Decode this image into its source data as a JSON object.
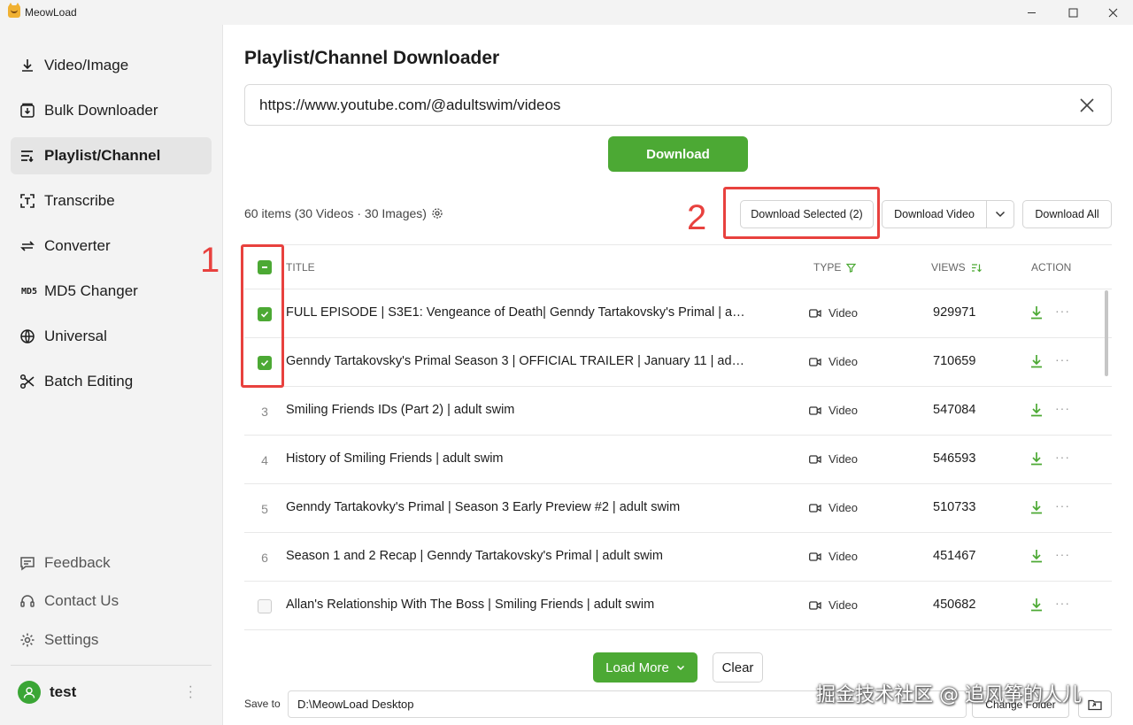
{
  "window": {
    "title": "MeowLoad",
    "minimize": "—",
    "maximize": "☐",
    "close": "✕"
  },
  "sidebar": {
    "items": [
      {
        "label": "Video/Image",
        "icon": "download-icon",
        "active": false
      },
      {
        "label": "Bulk Downloader",
        "icon": "bulk-download-icon",
        "active": false
      },
      {
        "label": "Playlist/Channel",
        "icon": "playlist-icon",
        "active": true
      },
      {
        "label": "Transcribe",
        "icon": "transcribe-icon",
        "active": false
      },
      {
        "label": "Converter",
        "icon": "converter-icon",
        "active": false
      },
      {
        "label": "MD5 Changer",
        "icon": "md5-icon",
        "icon_text": "MD5",
        "active": false
      },
      {
        "label": "Universal",
        "icon": "globe-icon",
        "active": false
      },
      {
        "label": "Batch Editing",
        "icon": "scissors-icon",
        "active": false
      }
    ],
    "bottom": [
      {
        "label": "Feedback",
        "icon": "feedback-icon"
      },
      {
        "label": "Contact Us",
        "icon": "headset-icon"
      },
      {
        "label": "Settings",
        "icon": "gear-icon"
      }
    ],
    "user": {
      "name": "test",
      "more": "⋮"
    }
  },
  "main": {
    "title": "Playlist/Channel Downloader",
    "url_value": "https://www.youtube.com/@adultswim/videos",
    "download_label": "Download",
    "summary": "60 items (30 Videos · 30 Images)",
    "toolbar": {
      "download_selected": "Download Selected (2)",
      "download_video": "Download Video",
      "download_all": "Download All"
    },
    "annotations": {
      "one": "1",
      "two": "2"
    },
    "table": {
      "headers": {
        "title": "TITLE",
        "type": "TYPE",
        "views": "VIEWS",
        "action": "ACTION"
      },
      "rows": [
        {
          "index": "",
          "checked": true,
          "title": "FULL EPISODE | S3E1: Vengeance of Death| Genndy Tartakovsky's Primal | ad...",
          "type": "Video",
          "views": "929971"
        },
        {
          "index": "",
          "checked": true,
          "title": "Genndy Tartakovsky's Primal Season 3 | OFFICIAL TRAILER | January 11 | adul...",
          "type": "Video",
          "views": "710659"
        },
        {
          "index": "3",
          "checked": false,
          "title": "Smiling Friends IDs (Part 2) | adult swim",
          "type": "Video",
          "views": "547084"
        },
        {
          "index": "4",
          "checked": false,
          "title": "History of Smiling Friends | adult swim",
          "type": "Video",
          "views": "546593"
        },
        {
          "index": "5",
          "checked": false,
          "title": "Genndy Tartakovky's Primal | Season 3 Early Preview #2 | adult swim",
          "type": "Video",
          "views": "510733"
        },
        {
          "index": "6",
          "checked": false,
          "title": "Season 1 and 2 Recap | Genndy Tartakovsky's Primal | adult swim",
          "type": "Video",
          "views": "451467"
        },
        {
          "index": "",
          "checked": false,
          "title": "Allan's Relationship With The Boss | Smiling Friends | adult swim",
          "type": "Video",
          "views": "450682"
        }
      ],
      "more_glyph": "···"
    },
    "load_more_label": "Load More",
    "clear_label": "Clear",
    "save_label": "Save to",
    "save_path": "D:\\MeowLoad Desktop",
    "change_folder_label": "Change Folder"
  },
  "watermark": "掘金技术社区 @ 追风筝的人儿",
  "colors": {
    "accent": "#4ca934",
    "annotation": "#e8413e",
    "sidebar_bg": "#f3f3f3"
  }
}
